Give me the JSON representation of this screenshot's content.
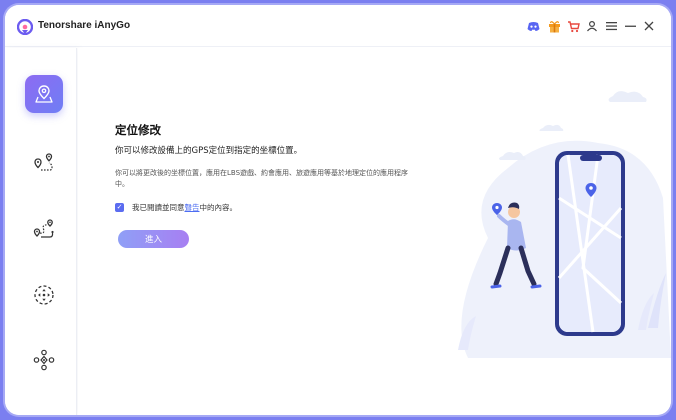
{
  "app": {
    "title": "Tenorshare iAnyGo"
  },
  "titlebar_icons": [
    "discord-icon",
    "gift-icon",
    "cart-icon",
    "user-icon",
    "menu-icon",
    "minimize-icon",
    "close-icon"
  ],
  "sidebar": {
    "items": [
      {
        "name": "change-location",
        "icon": "location-pin-map-icon",
        "active": true
      },
      {
        "name": "single-spot-movement",
        "icon": "two-pin-route-icon",
        "active": false
      },
      {
        "name": "multi-spot-movement",
        "icon": "multi-pin-route-icon",
        "active": false
      },
      {
        "name": "joystick-movement",
        "icon": "joystick-icon",
        "active": false
      },
      {
        "name": "gps-tools",
        "icon": "gps-dpad-icon",
        "active": false
      }
    ]
  },
  "main": {
    "heading": "定位修改",
    "subheading": "你可以修改設備上的GPS定位到指定的坐標位置。",
    "description": "你可以將更改後的坐標位置，應用在LBS遊戲、約會應用、旅遊應用等基於地理定位的應用程序中。",
    "agreement": {
      "checked": true,
      "prefix": "我已閱讀並同意",
      "link": "聲告",
      "suffix": "中的內容。"
    },
    "enter_button": "進入"
  },
  "colors": {
    "frame": "#7b7ff0",
    "accent": "#5b6cf0",
    "button_gradient_start": "#8f9ff6",
    "button_gradient_end": "#a77ff2",
    "gift": "#f39a1f",
    "cart": "#e8483f"
  }
}
